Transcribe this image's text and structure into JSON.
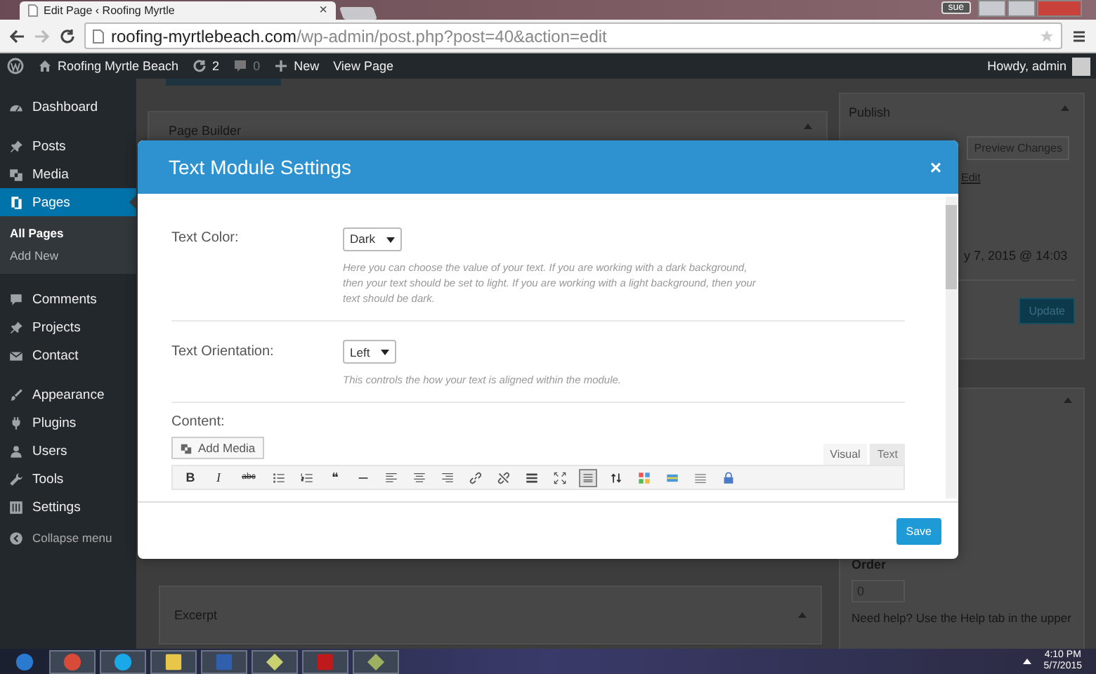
{
  "browser": {
    "tab_title": "Edit Page ‹ Roofing Myrtle",
    "tab_close": "×",
    "user": "sue",
    "url_host": "roofing-myrtlebeach.com",
    "url_path": "/wp-admin/post.php?post=40&action=edit"
  },
  "admin_bar": {
    "site": "Roofing Myrtle Beach",
    "updates": "2",
    "comments": "0",
    "new": "New",
    "view": "View Page",
    "greeting": "Howdy, admin"
  },
  "sidebar": {
    "items": [
      {
        "label": "Dashboard",
        "selected": false
      },
      {
        "label": "Posts",
        "selected": false
      },
      {
        "label": "Media",
        "selected": false
      },
      {
        "label": "Pages",
        "selected": true,
        "children": [
          {
            "label": "All Pages",
            "selected": true
          },
          {
            "label": "Add New",
            "selected": false
          }
        ]
      },
      {
        "label": "Comments",
        "selected": false
      },
      {
        "label": "Projects",
        "selected": false
      },
      {
        "label": "Contact",
        "selected": false
      },
      {
        "label": "Appearance",
        "selected": false
      },
      {
        "label": "Plugins",
        "selected": false
      },
      {
        "label": "Users",
        "selected": false
      },
      {
        "label": "Tools",
        "selected": false
      },
      {
        "label": "Settings",
        "selected": false
      }
    ],
    "collapse": "Collapse menu"
  },
  "background": {
    "page_builder": "Page Builder",
    "excerpt": "Excerpt",
    "publish": "Publish",
    "preview": "Preview Changes",
    "edit_link": "Edit",
    "date": "y 7, 2015 @ 14:03",
    "update": "Update",
    "order_label": "Order",
    "order_value": "0",
    "help": "Need help? Use the Help tab in the upper"
  },
  "modal": {
    "title": "Text Module Settings",
    "close": "×",
    "fields": [
      {
        "label": "Text Color:",
        "value": "Dark",
        "description": "Here you can choose the value of your text. If you are working with a dark background, then your text should be set to light. If you are working with a light background, then your text should be dark."
      },
      {
        "label": "Text Orientation:",
        "value": "Left",
        "description": "This controls the how your text is aligned within the module."
      }
    ],
    "content_label": "Content:",
    "add_media": "Add Media",
    "editor_tabs": [
      {
        "label": "Visual",
        "selected": false
      },
      {
        "label": "Text",
        "selected": true
      }
    ],
    "toolbar": [
      {
        "kind": "bold",
        "label": "B",
        "active": false
      },
      {
        "kind": "italic",
        "label": "I",
        "active": false
      },
      {
        "kind": "strike",
        "label": "abc",
        "active": false
      },
      {
        "kind": "bullet-list",
        "active": false
      },
      {
        "kind": "numbered-list",
        "active": false
      },
      {
        "kind": "quote",
        "label": "❝",
        "active": false
      },
      {
        "kind": "horizontal-rule",
        "active": false
      },
      {
        "kind": "align-left",
        "active": false
      },
      {
        "kind": "align-center",
        "active": false
      },
      {
        "kind": "align-right",
        "active": false
      },
      {
        "kind": "link",
        "active": false
      },
      {
        "kind": "unlink",
        "active": false
      },
      {
        "kind": "read-more",
        "active": false
      },
      {
        "kind": "fullscreen",
        "active": false
      },
      {
        "kind": "toolbar-toggle",
        "active": true
      },
      {
        "kind": "up-down-arrows",
        "active": false
      },
      {
        "kind": "color-grid",
        "active": false
      },
      {
        "kind": "banner",
        "active": false
      },
      {
        "kind": "lines",
        "active": false
      },
      {
        "kind": "lock",
        "active": false
      }
    ],
    "save": "Save"
  },
  "taskbar": {
    "time": "4:10 PM",
    "date": "5/7/2015"
  }
}
